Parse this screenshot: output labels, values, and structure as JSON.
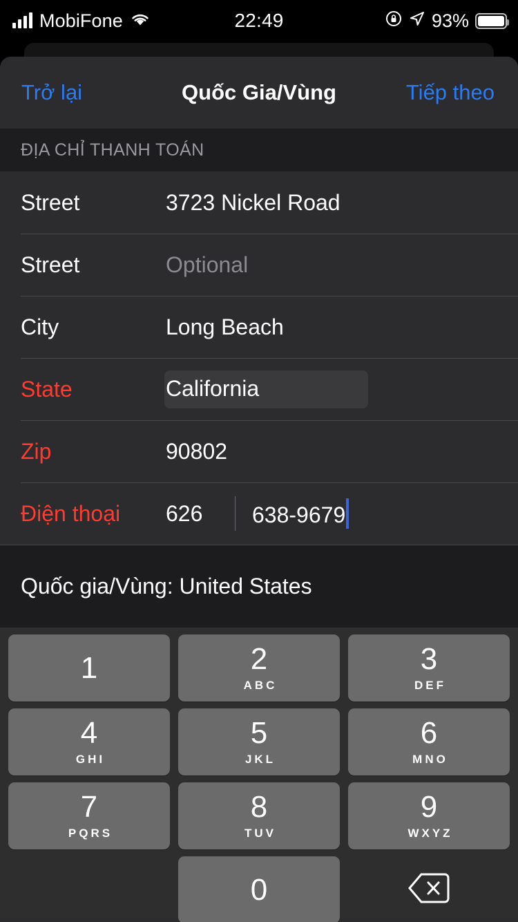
{
  "statusbar": {
    "carrier": "MobiFone",
    "time": "22:49",
    "battery_percent": "93%",
    "signal_icon": "cellular-bars-icon",
    "wifi_icon": "wifi-icon",
    "rotation_lock_icon": "rotation-lock-icon",
    "location_icon": "location-arrow-icon",
    "battery_icon": "battery-icon"
  },
  "navbar": {
    "back_label": "Trở lại",
    "title": "Quốc Gia/Vùng",
    "next_label": "Tiếp theo",
    "accent_color": "#2b7bf3"
  },
  "section": {
    "header": "ĐỊA CHỈ THANH TOÁN"
  },
  "form": {
    "rows": [
      {
        "label": "Street",
        "value": "3723 Nickel Road",
        "placeholder": "",
        "required": false,
        "highlighted": false
      },
      {
        "label": "Street",
        "value": "",
        "placeholder": "Optional",
        "required": false,
        "highlighted": false
      },
      {
        "label": "City",
        "value": "Long Beach",
        "placeholder": "",
        "required": false,
        "highlighted": false
      },
      {
        "label": "State",
        "value": "California",
        "placeholder": "",
        "required": true,
        "highlighted": true
      },
      {
        "label": "Zip",
        "value": "90802",
        "placeholder": "",
        "required": true,
        "highlighted": false
      }
    ],
    "phone_row": {
      "label": "Điện thoại",
      "area_code": "626",
      "number": "638-9679",
      "required": true,
      "caret_color": "#3f62d4"
    },
    "required_color": "#ff3b30"
  },
  "country": {
    "text": "Quốc gia/Vùng: United States"
  },
  "keypad": {
    "keys": [
      {
        "digit": "1",
        "letters": ""
      },
      {
        "digit": "2",
        "letters": "ABC"
      },
      {
        "digit": "3",
        "letters": "DEF"
      },
      {
        "digit": "4",
        "letters": "GHI"
      },
      {
        "digit": "5",
        "letters": "JKL"
      },
      {
        "digit": "6",
        "letters": "MNO"
      },
      {
        "digit": "7",
        "letters": "PQRS"
      },
      {
        "digit": "8",
        "letters": "TUV"
      },
      {
        "digit": "9",
        "letters": "WXYZ"
      },
      {
        "digit": "0",
        "letters": ""
      }
    ],
    "delete_icon": "delete-backspace-icon",
    "key_color": "#6b6b6b",
    "background_color": "#2e2e2e"
  }
}
